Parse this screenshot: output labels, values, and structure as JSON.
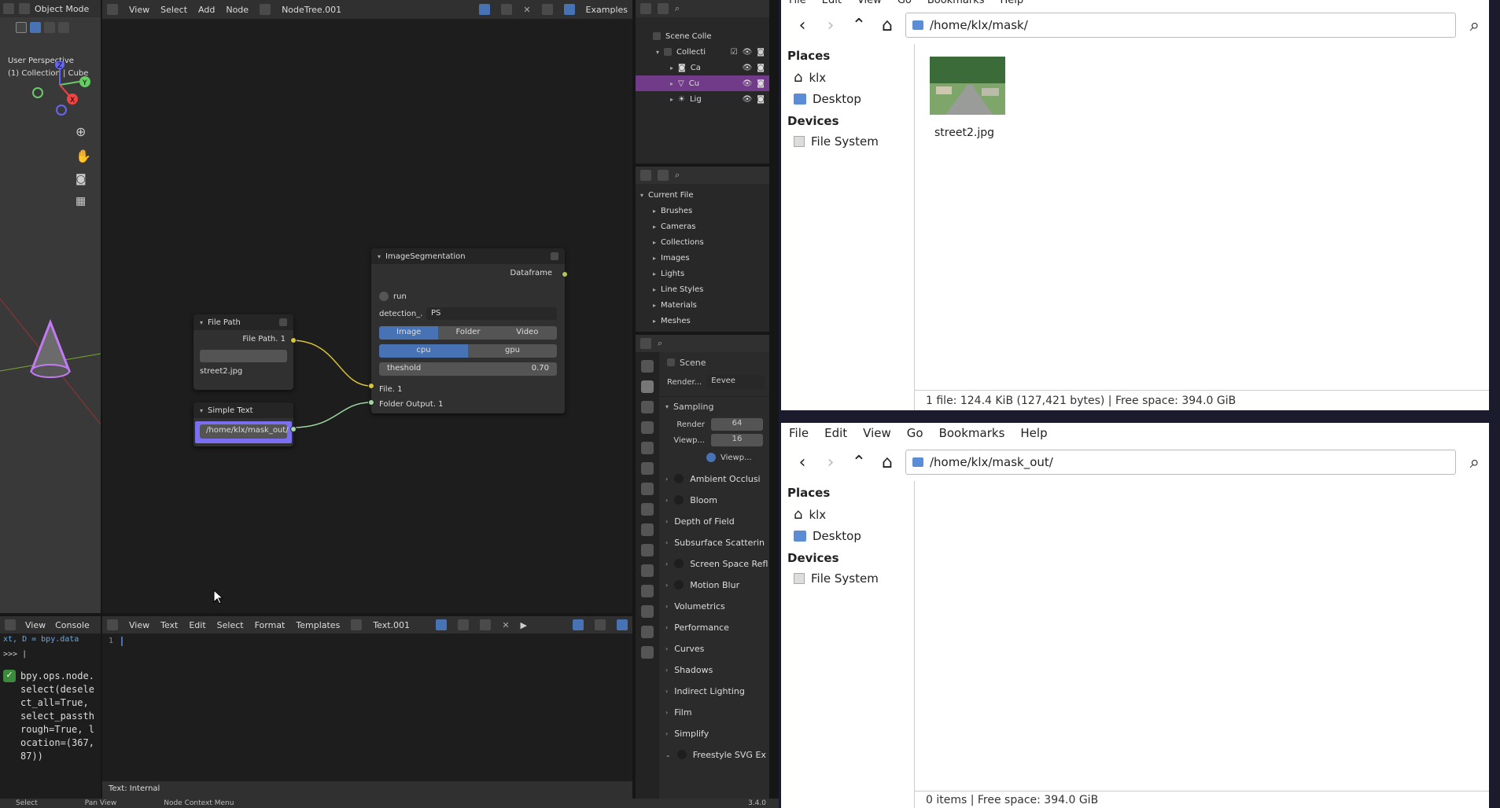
{
  "viewport": {
    "mode": "Object Mode",
    "view_label": "User Perspective",
    "collection_label": "(1) Collection | Cube"
  },
  "node_editor": {
    "menus": [
      "View",
      "Select",
      "Add",
      "Node"
    ],
    "tree_name": "NodeTree.001",
    "examples": "Examples"
  },
  "nodes": {
    "file_path": {
      "title": "File Path",
      "output": "File Path. 1",
      "filename": "street2.jpg"
    },
    "simple_text": {
      "title": "Simple Text",
      "value": "/home/klx/mask_out/"
    },
    "segmentation": {
      "title": "ImageSegmentation",
      "output": "Dataframe",
      "run": "run",
      "detection_label": "detection_...",
      "detection_value": "PS",
      "tabs": [
        "Image",
        "Folder",
        "Video"
      ],
      "devices": [
        "cpu",
        "gpu"
      ],
      "threshold_label": "theshold",
      "threshold_value": "0.70",
      "input_file": "File. 1",
      "input_folder": "Folder Output. 1"
    }
  },
  "outliner": {
    "root": "Scene Colle",
    "collection": "Collecti",
    "items": [
      "Ca",
      "Cu",
      "Lig"
    ]
  },
  "data_browser": {
    "current_file": "Current File",
    "items": [
      "Brushes",
      "Cameras",
      "Collections",
      "Images",
      "Lights",
      "Line Styles",
      "Materials",
      "Meshes"
    ]
  },
  "properties": {
    "scene": "Scene",
    "render_engine_label": "Render...",
    "render_engine": "Eevee",
    "sampling": "Sampling",
    "render_label": "Render",
    "render_value": "64",
    "viewport_label": "Viewp...",
    "viewport_value": "16",
    "viewport_denoise": "Viewp...",
    "sections": [
      "Ambient Occlusi",
      "Bloom",
      "Depth of Field",
      "Subsurface Scatterin",
      "Screen Space Refl",
      "Motion Blur",
      "Volumetrics",
      "Performance",
      "Curves",
      "Shadows",
      "Indirect Lighting",
      "Film",
      "Simplify",
      "Freestyle SVG Ex"
    ]
  },
  "console": {
    "menus": [
      "View",
      "Console"
    ],
    "line1": "xt, D = bpy.data",
    "prompt": ">>>",
    "info": "bpy.ops.node.select(deselect_all=True, select_passthrough=True, location=(367, 87))"
  },
  "text_editor": {
    "menus": [
      "View",
      "Text",
      "Edit",
      "Select",
      "Format",
      "Templates"
    ],
    "name": "Text.001",
    "line_no": "1",
    "footer": "Text: Internal"
  },
  "statusbar": {
    "select": "Select",
    "pan": "Pan View",
    "context": "Node Context Menu",
    "version": "3.4.0"
  },
  "fm1": {
    "menus": [
      "File",
      "Edit",
      "View",
      "Go",
      "Bookmarks",
      "Help"
    ],
    "path": "/home/klx/mask/",
    "places": "Places",
    "home": "klx",
    "desktop": "Desktop",
    "devices": "Devices",
    "filesystem": "File System",
    "file": "street2.jpg",
    "status": "1 file: 124.4 KiB (127,421 bytes) | Free space: 394.0 GiB"
  },
  "fm2": {
    "menus": [
      "File",
      "Edit",
      "View",
      "Go",
      "Bookmarks",
      "Help"
    ],
    "path": "/home/klx/mask_out/",
    "places": "Places",
    "home": "klx",
    "desktop": "Desktop",
    "devices": "Devices",
    "filesystem": "File System",
    "status": "0 items | Free space: 394.0 GiB"
  }
}
